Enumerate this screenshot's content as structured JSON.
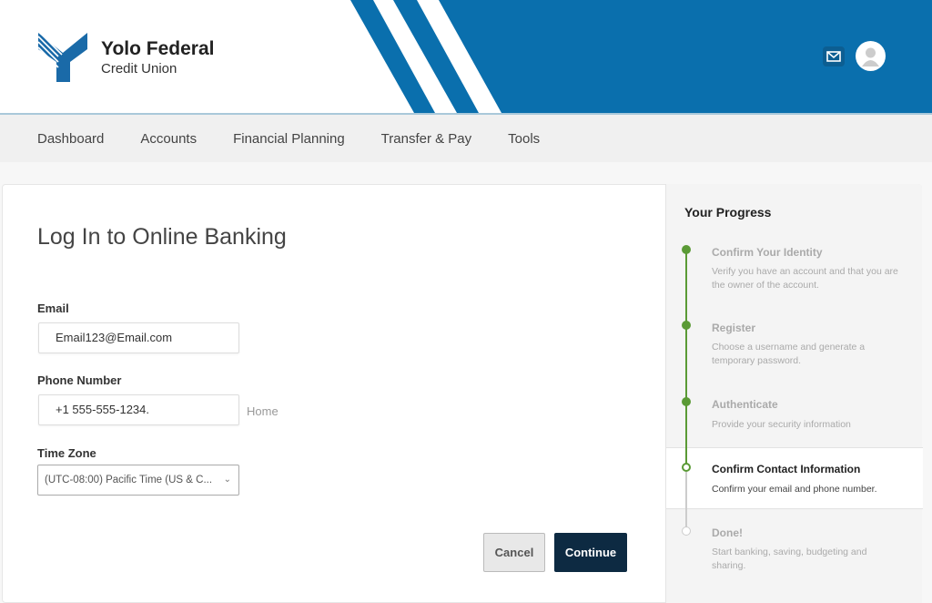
{
  "header": {
    "brand_line1": "Yolo Federal",
    "brand_line2": "Credit Union",
    "brand_color": "#0a6fad"
  },
  "nav": [
    "Dashboard",
    "Accounts",
    "Financial Planning",
    "Transfer & Pay",
    "Tools"
  ],
  "form": {
    "title": "Log In to Online Banking",
    "email_label": "Email",
    "email_value": "Email123@Email.com",
    "phone_label": "Phone Number",
    "phone_value": "+1 555-555-1234.",
    "phone_type": "Home",
    "tz_label": "Time Zone",
    "tz_value": "(UTC-08:00) Pacific Time (US & C...",
    "cancel": "Cancel",
    "continue": "Continue"
  },
  "progress": {
    "title": "Your Progress",
    "steps": [
      {
        "title": "Confirm Your Identity",
        "desc": "Verify you have an account and that you are the owner of the account.",
        "status": "complete"
      },
      {
        "title": "Register",
        "desc": "Choose a username and generate a temporary password.",
        "status": "complete"
      },
      {
        "title": "Authenticate",
        "desc": "Provide your security information",
        "status": "complete"
      },
      {
        "title": "Confirm Contact Information",
        "desc": "Confirm your email and phone number.",
        "status": "current"
      },
      {
        "title": "Done!",
        "desc": "Start banking, saving, budgeting and sharing.",
        "status": "pending"
      }
    ],
    "complete_color": "#5a9a35"
  }
}
